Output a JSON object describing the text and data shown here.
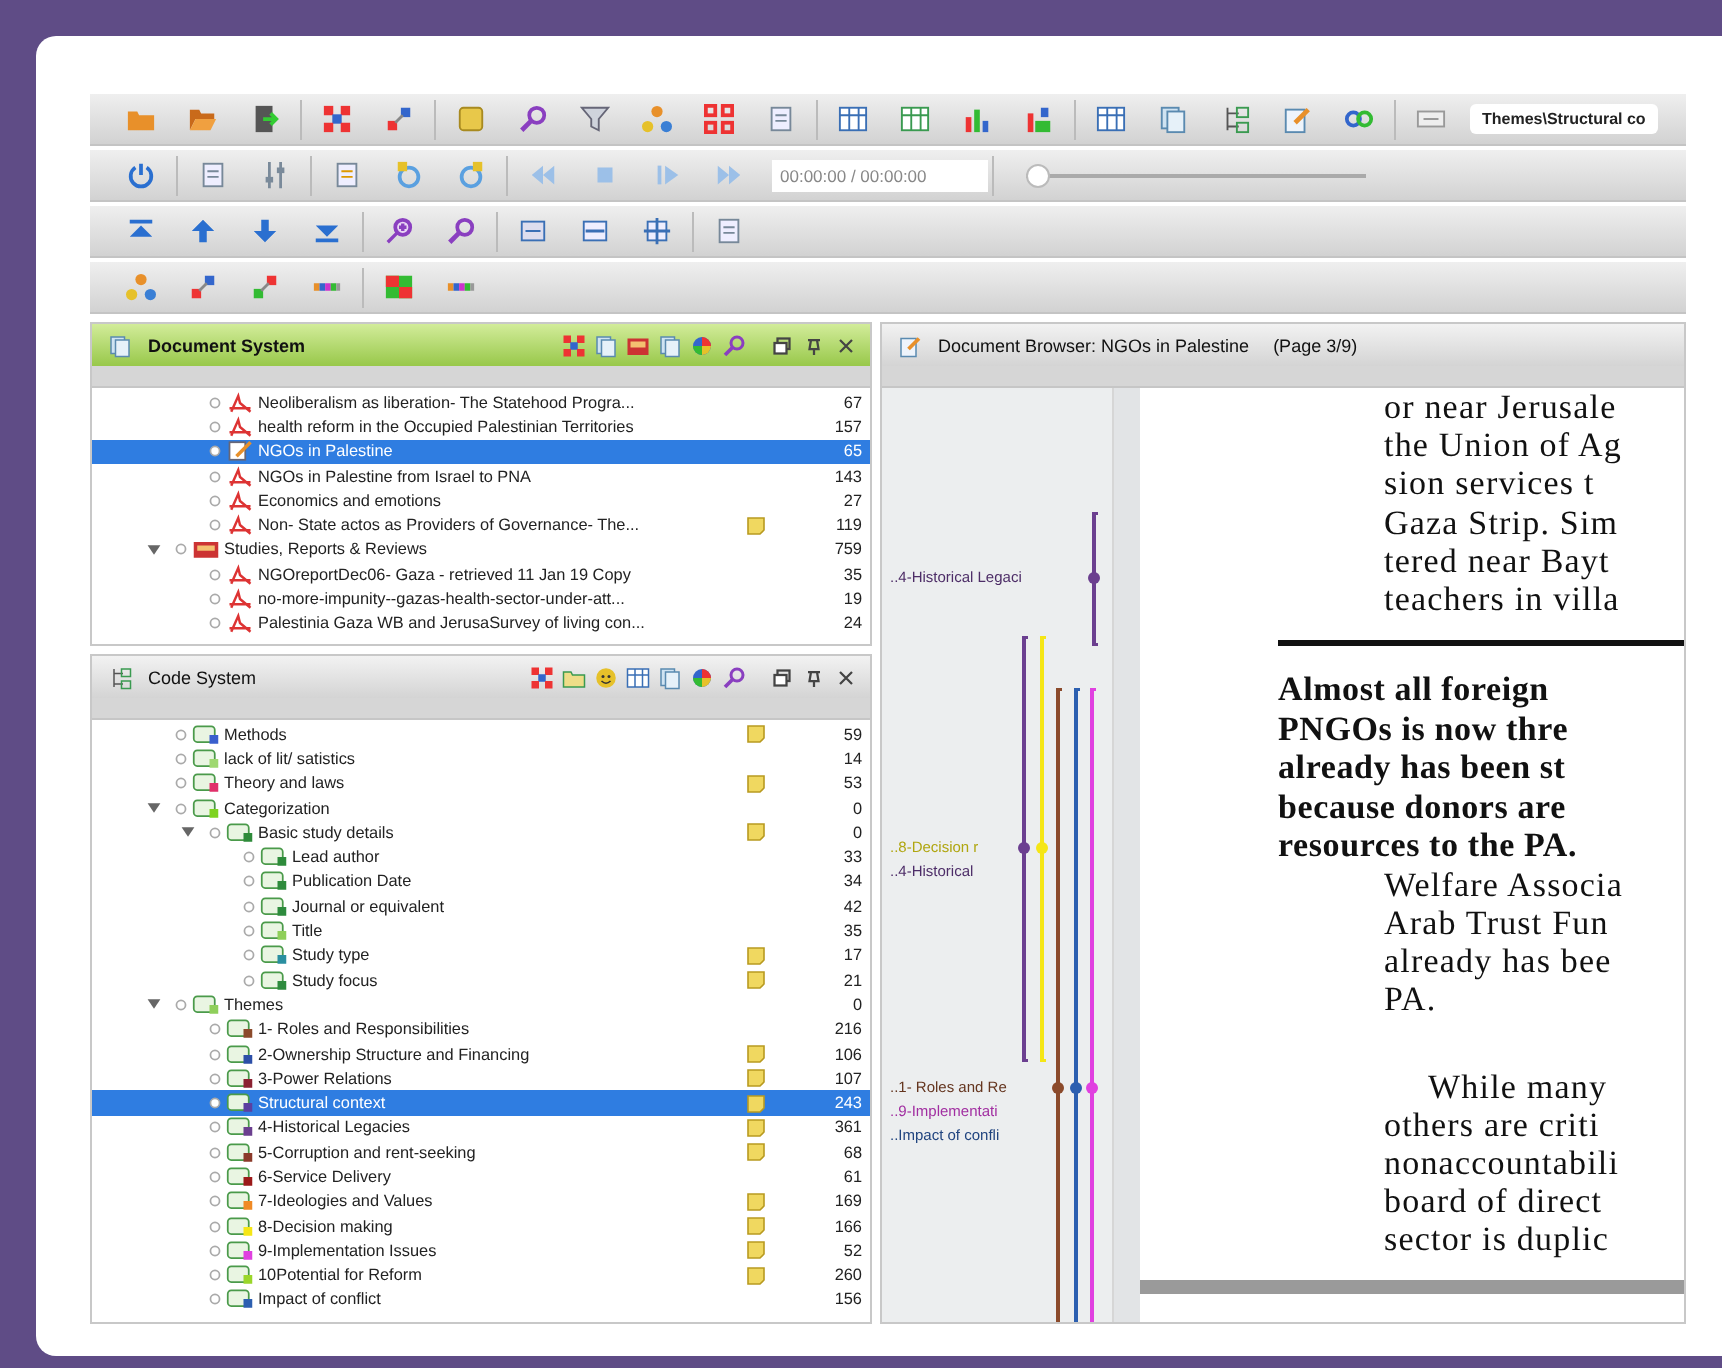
{
  "toolbar": {
    "code_field": "Themes\\Structural co",
    "media_time": "00:00:00 / 00:00:00",
    "media_slider": {
      "level": 0
    }
  },
  "document_system": {
    "title": "Document System",
    "items": [
      {
        "children": [
          {
            "children": [
              {
                "label": "Neoliberalism as liberation- The Statehood Progra...",
                "kind": "pdf",
                "memo": false,
                "count": "67",
                "selected": false
              },
              {
                "label": "health reform in the Occupied Palestinian Territories",
                "kind": "pdf",
                "memo": false,
                "count": "157",
                "selected": false
              },
              {
                "label": "NGOs in Palestine",
                "kind": "text",
                "memo": false,
                "count": "65",
                "selected": true
              },
              {
                "label": "NGOs in Palestine from Israel to PNA",
                "kind": "pdf",
                "memo": false,
                "count": "143",
                "selected": false
              },
              {
                "label": "Economics and emotions",
                "kind": "pdf",
                "memo": false,
                "count": "27",
                "selected": false
              },
              {
                "label": "Non- State actos as Providers of Governance- The...",
                "kind": "pdf",
                "memo": true,
                "count": "119",
                "selected": false
              }
            ]
          },
          {
            "label": "Studies, Reports & Reviews",
            "kind": "set",
            "memo": false,
            "count": "759",
            "selected": false,
            "expanded": true,
            "children": [
              {
                "label": "NGOreportDec06- Gaza - retrieved 11 Jan 19 Copy",
                "kind": "pdf",
                "memo": false,
                "count": "35",
                "selected": false
              },
              {
                "label": "no-more-impunity--gazas-health-sector-under-att...",
                "kind": "pdf",
                "memo": false,
                "count": "19",
                "selected": false
              },
              {
                "label": "Palestinia Gaza WB and JerusaSurvey of living con...",
                "kind": "pdf",
                "memo": false,
                "count": "24",
                "selected": false
              }
            ]
          }
        ]
      }
    ]
  },
  "code_system": {
    "title": "Code System",
    "items": [
      {
        "children": [
          {
            "label": "Methods",
            "color": "#3a5fcd",
            "memo": true,
            "count": "59",
            "selected": false
          },
          {
            "label": "lack of lit/ satistics",
            "color": "#9fd870",
            "memo": false,
            "count": "14",
            "selected": false
          },
          {
            "label": "Theory and laws",
            "color": "#e0306a",
            "memo": true,
            "count": "53",
            "selected": false
          },
          {
            "label": "Categorization",
            "color": "#7ed321",
            "memo": false,
            "count": "0",
            "selected": false,
            "expanded": true,
            "children": [
              {
                "label": "Basic study details",
                "color": "#2e8b3a",
                "memo": true,
                "count": "0",
                "selected": false,
                "expanded": true,
                "children": [
                  {
                    "label": "Lead author",
                    "color": "#2e8b3b",
                    "memo": false,
                    "count": "33",
                    "selected": false
                  },
                  {
                    "label": "Publication Date",
                    "color": "#2e8b3c",
                    "memo": false,
                    "count": "34",
                    "selected": false
                  },
                  {
                    "label": "Journal or equivalent",
                    "color": "#2e8b3d",
                    "memo": false,
                    "count": "42",
                    "selected": false
                  },
                  {
                    "label": "Title",
                    "color": "#8fcf5a",
                    "memo": false,
                    "count": "35",
                    "selected": false
                  },
                  {
                    "label": "Study type",
                    "color": "#2a8fa0",
                    "memo": true,
                    "count": "17",
                    "selected": false
                  },
                  {
                    "label": "Study focus",
                    "color": "#2e8b3e",
                    "memo": true,
                    "count": "21",
                    "selected": false
                  }
                ]
              }
            ]
          },
          {
            "label": "Themes",
            "color": "#8fcf5b",
            "memo": false,
            "count": "0",
            "selected": false,
            "expanded": true,
            "children": [
              {
                "label": "1- Roles and Responsibilities",
                "color": "#8b4a2b",
                "memo": false,
                "count": "216",
                "selected": false
              },
              {
                "label": "2-Ownership Structure and Financing",
                "color": "#2c4fa8",
                "memo": true,
                "count": "106",
                "selected": false
              },
              {
                "label": "3-Power Relations",
                "color": "#8b2232",
                "memo": true,
                "count": "107",
                "selected": false
              },
              {
                "label": "Structural context",
                "color": "#5b3fa0",
                "memo": true,
                "count": "243",
                "selected": true
              },
              {
                "label": "4-Historical Legacies",
                "color": "#6b3f8f",
                "memo": true,
                "count": "361",
                "selected": false
              },
              {
                "label": "5-Corruption and rent-seeking",
                "color": "#8b3a2a",
                "memo": true,
                "count": "68",
                "selected": false
              },
              {
                "label": "6-Service Delivery",
                "color": "#9b1a1a",
                "memo": false,
                "count": "61",
                "selected": false
              },
              {
                "label": "7-Ideologies and Values",
                "color": "#f08a24",
                "memo": true,
                "count": "169",
                "selected": false
              },
              {
                "label": "8-Decision making",
                "color": "#f5e616",
                "memo": true,
                "count": "166",
                "selected": false
              },
              {
                "label": "9-Implementation Issues",
                "color": "#e040e0",
                "memo": true,
                "count": "52",
                "selected": false
              },
              {
                "label": "10Potential for Reform",
                "color": "#9ad62a",
                "memo": true,
                "count": "260",
                "selected": false
              },
              {
                "label": "Impact of conflict",
                "color": "#2c5fb0",
                "memo": false,
                "count": "156",
                "selected": false
              }
            ]
          }
        ]
      }
    ]
  },
  "document_browser": {
    "title": "Document Browser: NGOs in Palestine",
    "page": "(Page 3/9)",
    "code_stripes": [
      {
        "label": "..4-Historical Legaci",
        "color": "#6b3f8f"
      },
      {
        "label": "..8-Decision r",
        "color": "#f5e616"
      },
      {
        "label": "..4-Historical",
        "color": "#6b3f90"
      },
      {
        "label": "..1- Roles and Re",
        "color": "#8b4a2b"
      },
      {
        "label": "..9-Implementati",
        "color": "#e040e0"
      },
      {
        "label": "..Impact of confli",
        "color": "#2c5fb0"
      }
    ],
    "paragraphs": [
      {
        "kind": "body",
        "first_line_indent": false,
        "lines": [
          "or near Jerusale",
          "the Union of Ag",
          "sion services t",
          "Gaza Strip. Sim",
          "tered near Bayt",
          "teachers in villa"
        ]
      },
      {
        "kind": "rule"
      },
      {
        "kind": "bold",
        "first_line_indent": false,
        "lines": [
          "Almost all foreign",
          "PNGOs is now thre",
          "already has been st",
          "because donors are",
          "resources to the PA."
        ]
      },
      {
        "kind": "body",
        "first_line_indent": false,
        "lines": [
          "Welfare Associa",
          "Arab Trust Fun",
          "already has bee",
          "PA."
        ]
      },
      {
        "kind": "body",
        "first_line_indent": true,
        "lines": [
          "While many",
          "others are criti",
          "nonaccountabili",
          "board of direct",
          "sector is duplic"
        ]
      }
    ]
  }
}
